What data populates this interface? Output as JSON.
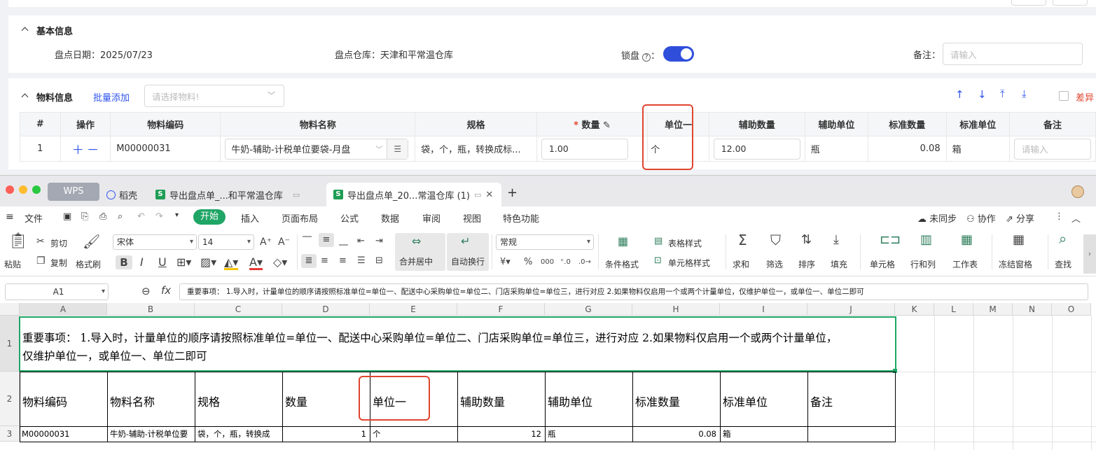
{
  "basic": {
    "title": "基本信息",
    "date_label": "盘点日期：",
    "date_value": "2025/07/23",
    "warehouse_label": "盘点仓库：",
    "warehouse_value": "天津和平常温仓库",
    "lock_label": "锁盘",
    "lock_colon": "：",
    "remark_label": "备注：",
    "remark_placeholder": "请输入"
  },
  "material": {
    "title": "物料信息",
    "batch_add": "批量添加",
    "select_placeholder": "请选择物料!",
    "diff_label": "差异",
    "headers": [
      "#",
      "操作",
      "物料编码",
      "物料名称",
      "规格",
      "数量",
      "单位一",
      "辅助数量",
      "辅助单位",
      "标准数量",
      "标准单位",
      "备注"
    ],
    "row": {
      "index": "1",
      "code": "M00000031",
      "name": "牛奶-辅助-计税单位要袋-月盘",
      "spec": "袋，个，瓶，转换成标...",
      "qty": "1.00",
      "unit1": "个",
      "aux_qty": "12.00",
      "aux_unit": "瓶",
      "std_qty": "0.08",
      "std_unit": "箱",
      "remark_placeholder": "请输入"
    }
  },
  "wps": {
    "tabs": {
      "wps": "WPS",
      "daoke": "稻壳",
      "file1": "导出盘点单_...和平常温仓库",
      "file2": "导出盘点单_20...常温仓库 (1)"
    },
    "menu": {
      "file": "文件",
      "start": "开始",
      "items": [
        "插入",
        "页面布局",
        "公式",
        "数据",
        "审阅",
        "视图",
        "特色功能"
      ],
      "unsynced": "未同步",
      "collab": "协作",
      "share": "分享"
    },
    "ribbon": {
      "paste": "粘贴",
      "cut": "剪切",
      "copy": "复制",
      "format_brush": "格式刷",
      "font": "宋体",
      "size": "14",
      "merge": "合并居中",
      "wrap": "自动换行",
      "numfmt": "常规",
      "cond_fmt": "条件格式",
      "table_style": "表格样式",
      "cell_style": "单元格样式",
      "sum": "求和",
      "filter": "筛选",
      "sort": "排序",
      "fill": "填充",
      "cell": "单元格",
      "rowcol": "行和列",
      "sheet": "工作表",
      "freeze": "冻结窗格",
      "find": "查找"
    },
    "namebox": "A1",
    "formula": "重要事项： 1.导入时，计量单位的顺序请按照标准单位=单位一、配送中心采购单位=单位二、门店采购单位=单位三，进行对应 2.如果物料仅启用一个或两个计量单位，仅维护单位一，或单位一、单位二即可",
    "columns": [
      "A",
      "B",
      "C",
      "D",
      "E",
      "F",
      "G",
      "H",
      "I",
      "J",
      "K",
      "L",
      "M",
      "N",
      "O"
    ],
    "rows": [
      "1",
      "2",
      "3"
    ],
    "row1_line1": "重要事项： 1.导入时，计量单位的顺序请按照标准单位=单位一、配送中心采购单位=单位二、门店采购单位=单位三，进行对应 2.如果物料仅启用一个或两个计量单位，",
    "row1_line2": "仅维护单位一，或单位一、单位二即可",
    "headers": [
      "物料编码",
      "物料名称",
      "规格",
      "数量",
      "单位一",
      "辅助数量",
      "辅助单位",
      "标准数量",
      "标准单位",
      "备注"
    ],
    "data_row": [
      "M00000031",
      "牛奶-辅助-计税单位要",
      "袋，个，瓶，转换成",
      "1",
      "个",
      "12",
      "瓶",
      "0.08",
      "箱",
      ""
    ]
  }
}
